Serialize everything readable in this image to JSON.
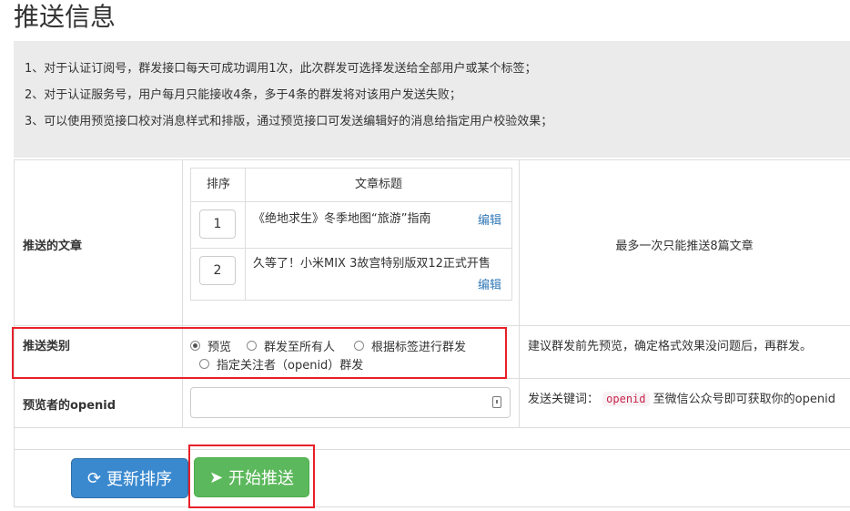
{
  "page": {
    "title": "推送信息"
  },
  "notice": {
    "lines": [
      "1、对于认证订阅号，群发接口每天可成功调用1次，此次群发可选择发送给全部用户或某个标签；",
      "2、对于认证服务号，用户每月只能接收4条，多于4条的群发将对该用户发送失败；",
      "3、可以使用预览接口校对消息样式和排版，通过预览接口可发送编辑好的消息给指定用户校验效果；"
    ]
  },
  "articles": {
    "label": "推送的文章",
    "col_order": "排序",
    "col_title": "文章标题",
    "edit_label": "编辑",
    "hint": "最多一次只能推送8篇文章",
    "rows": [
      {
        "order": "1",
        "title": "《绝地求生》冬季地图“旅游”指南"
      },
      {
        "order": "2",
        "title": "久等了！小米MIX 3故宫特别版双12正式开售"
      }
    ]
  },
  "push_type": {
    "label": "推送类别",
    "options": [
      "预览",
      "群发至所有人",
      "根据标签进行群发",
      "指定关注者（openid）群发"
    ],
    "selected": "预览",
    "hint": "建议群发前先预览，确定格式效果没问题后，再群发。"
  },
  "openid": {
    "label": "预览者的openid",
    "value": "",
    "hint_prefix": "发送关键词：",
    "hint_code": "openid",
    "hint_suffix": "至微信公众号即可获取你的openid"
  },
  "buttons": {
    "refresh_label": "更新排序",
    "push_label": "开始推送"
  },
  "colors": {
    "refresh_button": "#3a89cf",
    "push_button": "#5cb85c",
    "highlight": "#e8202a",
    "link": "#337ab7"
  }
}
